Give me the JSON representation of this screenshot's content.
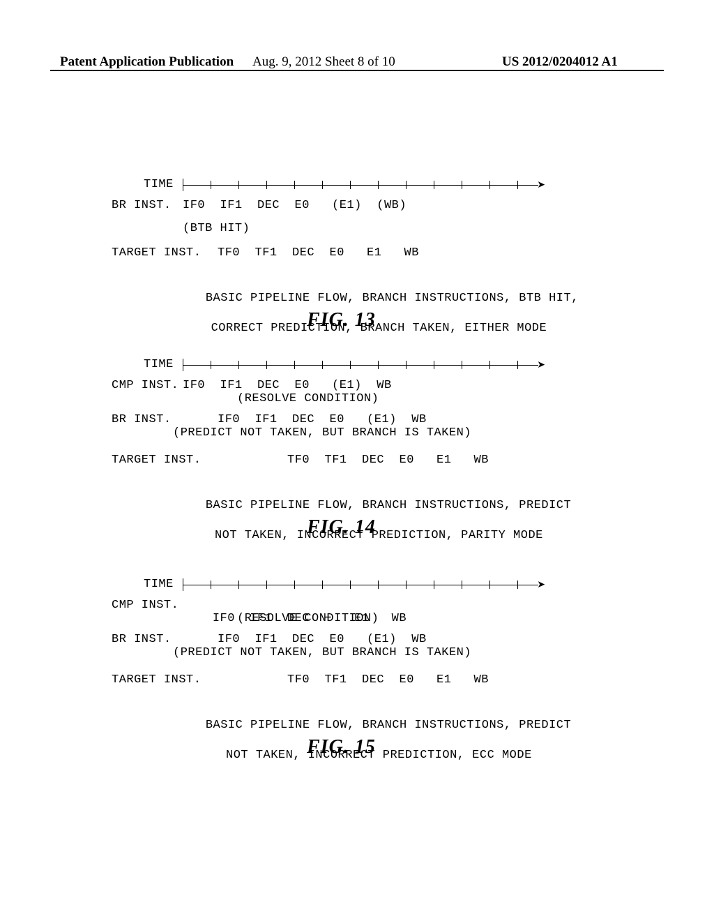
{
  "header": {
    "left": "Patent Application Publication",
    "center": "Aug. 9, 2012  Sheet 8 of 10",
    "right": "US 2012/0204012 A1"
  },
  "glyphs": {
    "minus": "−",
    "arrow_right": "➤"
  },
  "common": {
    "time_label": "TIME",
    "col_label": "TARGET INST.",
    "br_label": "BR INST.",
    "cmp_label": "CMP INST.",
    "btb_hit": "(BTB HIT)"
  },
  "fig13": {
    "br_stages": "IF0  IF1  DEC  E0   (E1)  (WB)",
    "target_stages": "TF0  TF1  DEC  E0   E1   WB",
    "caption_line1": "BASIC PIPELINE FLOW, BRANCH INSTRUCTIONS, BTB HIT,",
    "caption_line2": "CORRECT PREDICTION, BRANCH TAKEN, EITHER MODE",
    "figlabel": "FIG. 13"
  },
  "fig14": {
    "cmp_stages": "IF0  IF1  DEC  E0   (E1)  WB",
    "cmp_note": "(RESOLVE CONDITION)",
    "br_stages": "IF0  IF1  DEC  E0   (E1)  WB",
    "br_note": "(PREDICT NOT TAKEN, BUT BRANCH IS TAKEN)",
    "target_stages": "TF0  TF1  DEC  E0   E1   WB",
    "caption_line1": "BASIC PIPELINE FLOW, BRANCH INSTRUCTIONS, PREDICT",
    "caption_line2": "NOT TAKEN, INCORRECT PREDICTION, PARITY MODE",
    "figlabel": "FIG. 14"
  },
  "fig15": {
    "cmp_stages_a": "IF0  IF1  DEC  ",
    "cmp_stages_b": "   E1   WB",
    "cmp_note": "(RESOLVE CONDITION)",
    "br_stages": "IF0  IF1  DEC  E0   (E1)  WB",
    "br_note": "(PREDICT NOT TAKEN, BUT BRANCH IS TAKEN)",
    "target_stages": "TF0  TF1  DEC  E0   E1   WB",
    "caption_line1": "BASIC PIPELINE FLOW, BRANCH INSTRUCTIONS, PREDICT",
    "caption_line2": "NOT TAKEN, INCORRECT PREDICTION, ECC MODE",
    "figlabel": "FIG. 15"
  }
}
